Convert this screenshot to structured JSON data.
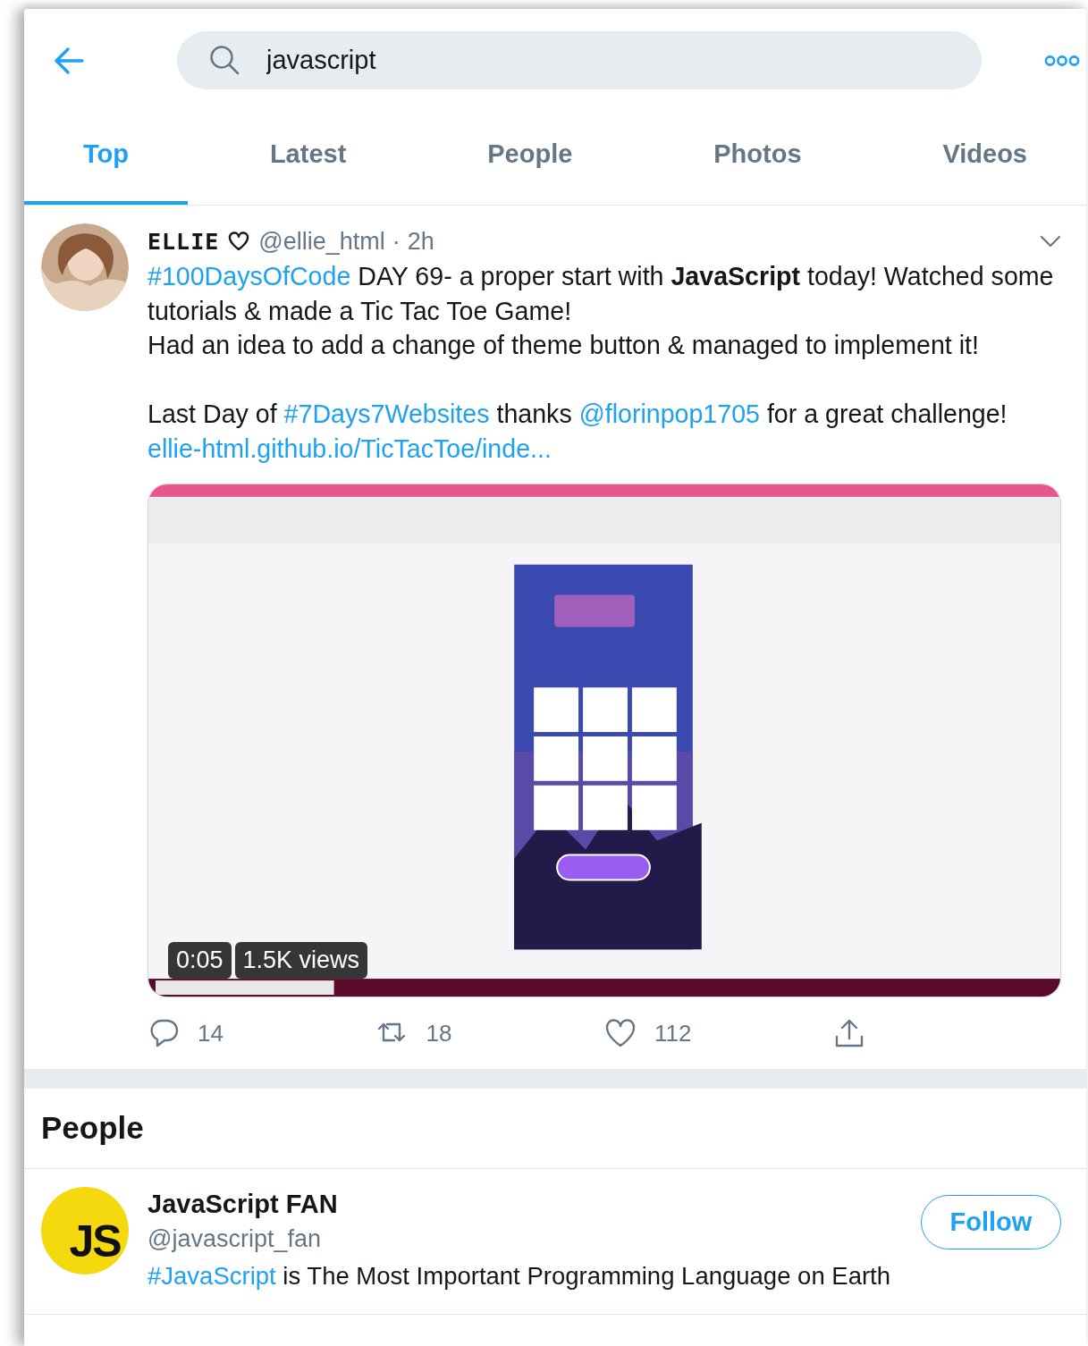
{
  "search": {
    "value": "javascript"
  },
  "tabs": [
    {
      "label": "Top",
      "selected": true
    },
    {
      "label": "Latest",
      "selected": false
    },
    {
      "label": "People",
      "selected": false
    },
    {
      "label": "Photos",
      "selected": false
    },
    {
      "label": "Videos",
      "selected": false
    }
  ],
  "tweet": {
    "name": "ELLIE",
    "handle": "@ellie_html",
    "separator": "·",
    "time": "2h",
    "paragraphs": [
      [
        {
          "kind": "link",
          "text": "#100DaysOfCode"
        },
        {
          "kind": "plain",
          "text": " DAY 69- a proper start with "
        },
        {
          "kind": "bold",
          "text": "JavaScript"
        },
        {
          "kind": "plain",
          "text": " today! Watched some tutorials & made a Tic Tac Toe Game!"
        }
      ],
      [
        {
          "kind": "plain",
          "text": "Had an idea to add a change of theme button & managed to implement it!"
        }
      ],
      [
        {
          "kind": "plain",
          "text": "Last Day of "
        },
        {
          "kind": "link",
          "text": "#7Days7Websites"
        },
        {
          "kind": "plain",
          "text": " thanks "
        },
        {
          "kind": "link",
          "text": "@florinpop1705"
        },
        {
          "kind": "plain",
          "text": " for a great challenge!"
        }
      ],
      [
        {
          "kind": "link",
          "text": "ellie-html.github.io/TicTacToe/inde..."
        }
      ]
    ],
    "video": {
      "kind": "picture",
      "duration": "0:05",
      "views": "1.5K views"
    },
    "actions": [
      {
        "kind": "reply",
        "count": "14"
      },
      {
        "kind": "retweet",
        "count": "18"
      },
      {
        "kind": "like",
        "count": "112"
      },
      {
        "kind": "share"
      }
    ]
  },
  "people": {
    "heading": "People",
    "items": [
      {
        "avatar_text": "JS",
        "name": "JavaScript FAN",
        "handle": "@javascript_fan",
        "bio": [
          {
            "kind": "link",
            "text": "#JavaScript"
          },
          {
            "kind": "plain",
            "text": " is The Most Important Programming Language on Earth"
          }
        ],
        "button": "Follow"
      }
    ]
  }
}
